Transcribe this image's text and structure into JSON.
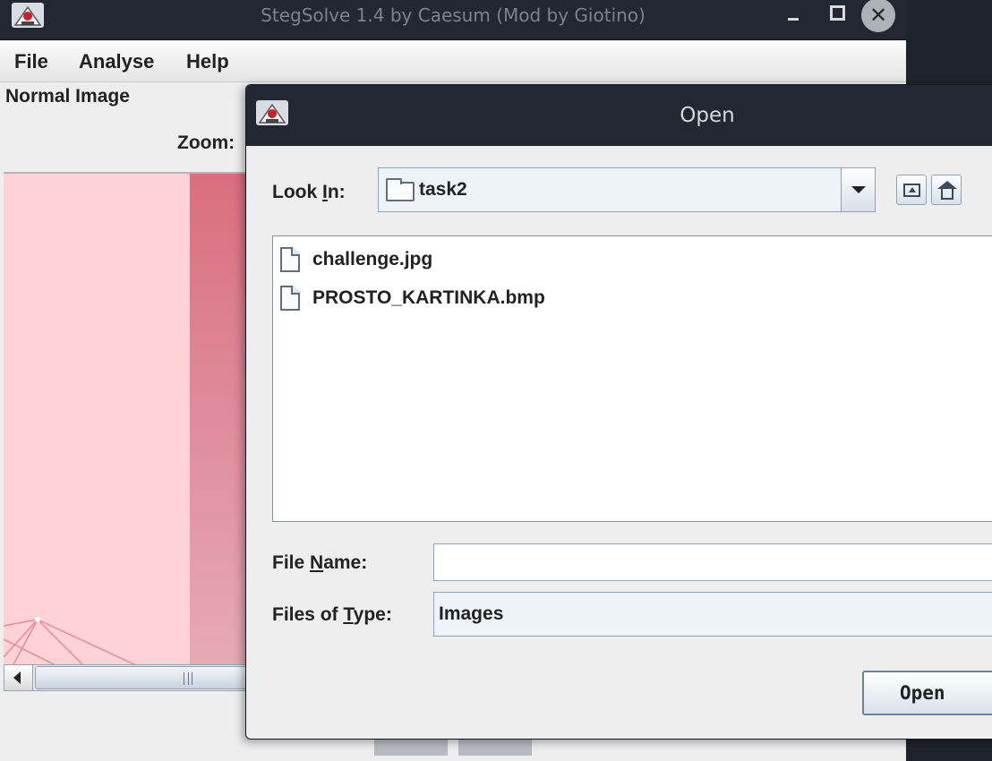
{
  "main_window": {
    "title": "StegSolve 1.4 by Caesum (Mod by Giotino)",
    "close_glyph": "✕",
    "menu": {
      "file": "File",
      "analyse": "Analyse",
      "help": "Help"
    },
    "mode_label": "Normal Image",
    "zoom_label": "Zoom:"
  },
  "dialog": {
    "title": "Open",
    "look_in": {
      "label_prefix": "Look ",
      "label_mnemonic": "I",
      "label_suffix": "n:",
      "value": "task2"
    },
    "files": [
      {
        "name": "challenge.jpg"
      },
      {
        "name": "PROSTO_KARTINKA.bmp"
      }
    ],
    "file_name": {
      "label_prefix": "File ",
      "label_mnemonic": "N",
      "label_suffix": "ame:",
      "value": ""
    },
    "files_of_type": {
      "label_prefix": "Files of ",
      "label_mnemonic": "T",
      "label_suffix": "ype:",
      "value": "Images"
    },
    "open_button": "Open"
  },
  "icons": {
    "app": "java-duke-icon",
    "folder": "folder-icon",
    "file": "file-icon",
    "up_folder": "up-folder-icon",
    "home": "home-icon"
  },
  "colors": {
    "titlebar": "#222731",
    "window_bg": "#eeeeee",
    "image_pink": "#ffd2d6",
    "image_band": "#d96e80"
  }
}
